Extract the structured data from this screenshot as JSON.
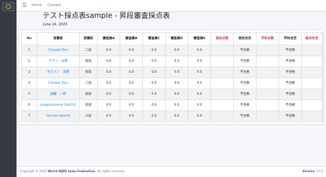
{
  "nav": {
    "toggle_icon": "hamburger-icon",
    "links": [
      "Home",
      "Contact"
    ]
  },
  "page": {
    "title": "テスト採点表sample - 昇段審査採点表",
    "date": "June 14, 2020"
  },
  "table": {
    "headers": [
      "No",
      "受審者",
      "受審段",
      "審査員A",
      "審査員B",
      "審査員C",
      "審査員D",
      "審査員E",
      "実技点数",
      "実技合否",
      "学科点数",
      "学科合否",
      "総合合否"
    ],
    "rows": [
      [
        "1",
        "Canada Taro",
        "二段",
        "0.0",
        "0.0",
        "0.0",
        "0.0",
        "0.0",
        "",
        "不合格",
        "",
        "不合格",
        ""
      ],
      [
        "2",
        "テスト　太郎",
        "初段",
        "0.0",
        "0.0",
        "0.0",
        "0.0",
        "0.0",
        "",
        "不合格",
        "",
        "不合格",
        ""
      ],
      [
        "3",
        "ボストン　次郎",
        "初段",
        "0.0",
        "0.0",
        "0.0",
        "0.0",
        "0.0",
        "",
        "不合格",
        "",
        "不合格",
        ""
      ],
      [
        "4",
        "Canada Taro",
        "二段",
        "0.0",
        "0.0",
        "0.0",
        "0.0",
        "0.0",
        "",
        "不合格",
        "",
        "不合格",
        ""
      ],
      [
        "5",
        "試験　一郎",
        "初段",
        "0.0",
        "0.0",
        "0.0",
        "0.0",
        "0.0",
        "",
        "不合格",
        "",
        "不合格",
        ""
      ],
      [
        "6",
        "Longtextname Test123",
        "初段",
        "0.0",
        "0.0",
        "0.0",
        "0.0",
        "0.0",
        "",
        "不合格",
        "",
        "不合格",
        ""
      ],
      [
        "7",
        "German Kenshi",
        "三段",
        "0.0",
        "0.0",
        "0.0",
        "0.0",
        "0.0",
        "",
        "不合格",
        "",
        "不合格",
        ""
      ]
    ],
    "red_header_indices": [
      8,
      10,
      12
    ],
    "link_column_index": 1
  },
  "footer": {
    "copyright_prefix": "Copyright © 2020 ",
    "copyright_org": "World MJER Iaido Federation.",
    "copyright_suffix": " All rights reserved.",
    "version_label": "Version",
    "version_number": "3.0.2"
  },
  "colors": {
    "sidebar": "#343a40",
    "link": "#007bff",
    "danger": "#dc3545",
    "stripe": "#f2f2f2"
  }
}
